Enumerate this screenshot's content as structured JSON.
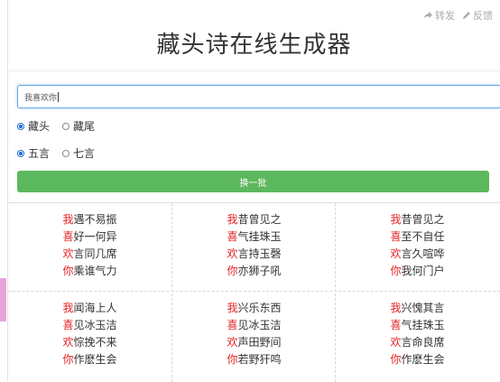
{
  "header": {
    "share_label": "转发",
    "feedback_label": "反馈",
    "title": "藏头诗在线生成器"
  },
  "input": {
    "value": "我喜欢你"
  },
  "position_options": [
    {
      "label": "藏头",
      "checked": true
    },
    {
      "label": "藏尾",
      "checked": false
    }
  ],
  "length_options": [
    {
      "label": "五言",
      "checked": true
    },
    {
      "label": "七言",
      "checked": false
    }
  ],
  "refresh_button": "换一批",
  "poems": [
    {
      "lines": [
        {
          "head": "我",
          "rest": "遇不易振"
        },
        {
          "head": "喜",
          "rest": "好一何异"
        },
        {
          "head": "欢",
          "rest": "言同几席"
        },
        {
          "head": "你",
          "rest": "乘谁气力"
        }
      ]
    },
    {
      "lines": [
        {
          "head": "我",
          "rest": "昔曾见之"
        },
        {
          "head": "喜",
          "rest": "气挂珠玉"
        },
        {
          "head": "欢",
          "rest": "言持玉磬"
        },
        {
          "head": "你",
          "rest": "亦狮子吼"
        }
      ]
    },
    {
      "lines": [
        {
          "head": "我",
          "rest": "昔曾见之"
        },
        {
          "head": "喜",
          "rest": "至不自任"
        },
        {
          "head": "欢",
          "rest": "言久喧哗"
        },
        {
          "head": "你",
          "rest": "我何门户"
        }
      ]
    },
    {
      "lines": [
        {
          "head": "我",
          "rest": "闻海上人"
        },
        {
          "head": "喜",
          "rest": "见冰玉洁"
        },
        {
          "head": "欢",
          "rest": "悰挽不来"
        },
        {
          "head": "你",
          "rest": "作麽生会"
        }
      ]
    },
    {
      "lines": [
        {
          "head": "我",
          "rest": "兴乐东西"
        },
        {
          "head": "喜",
          "rest": "见冰玉洁"
        },
        {
          "head": "欢",
          "rest": "声田野间"
        },
        {
          "head": "你",
          "rest": "若野犴鸣"
        }
      ]
    },
    {
      "lines": [
        {
          "head": "我",
          "rest": "兴愧其言"
        },
        {
          "head": "喜",
          "rest": "气挂珠玉"
        },
        {
          "head": "欢",
          "rest": "言命良席"
        },
        {
          "head": "你",
          "rest": "作麽生会"
        }
      ]
    }
  ]
}
